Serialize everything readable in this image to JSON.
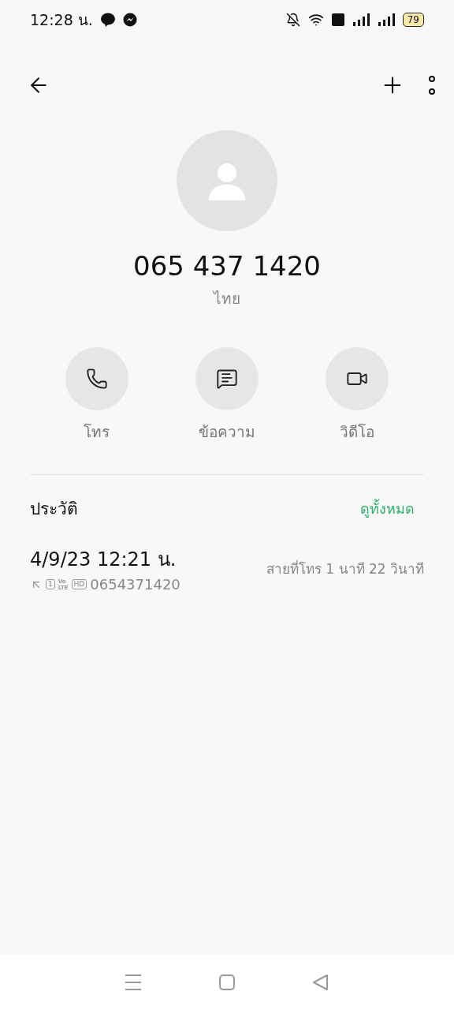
{
  "status_bar": {
    "time": "12:28 น.",
    "battery": "79"
  },
  "contact": {
    "number": "065 437 1420",
    "country": "ไทย"
  },
  "actions": [
    {
      "kind": "call",
      "label": "โทร"
    },
    {
      "kind": "message",
      "label": "ข้อความ"
    },
    {
      "kind": "video",
      "label": "วิดีโอ"
    }
  ],
  "history": {
    "title": "ประวัติ",
    "view_all": "ดูทั้งหมด",
    "entries": [
      {
        "datetime": "4/9/23 12:21 น.",
        "sim": "1",
        "volte": [
          "Vo",
          "LTE"
        ],
        "hd": "HD",
        "number": "0654371420",
        "summary": "สายที่โทร  1 นาที 22 วินาที"
      }
    ]
  }
}
